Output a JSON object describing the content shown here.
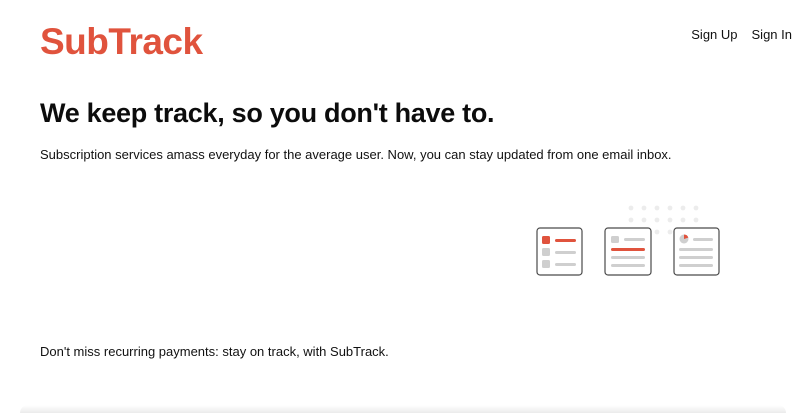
{
  "brand": {
    "name": "SubTrack",
    "color": "#e0533d"
  },
  "nav": {
    "sign_up": "Sign Up",
    "sign_in": "Sign In"
  },
  "hero": {
    "headline": "We keep track, so you don't have to.",
    "subtitle": "Subscription services amass everyday for the average user. Now, you can stay updated from one email inbox."
  },
  "illustration": {
    "icon": "checklist-cards-illustration",
    "card_count": 3
  },
  "footer": {
    "tagline": "Don't miss recurring payments: stay on track, with SubTrack."
  }
}
